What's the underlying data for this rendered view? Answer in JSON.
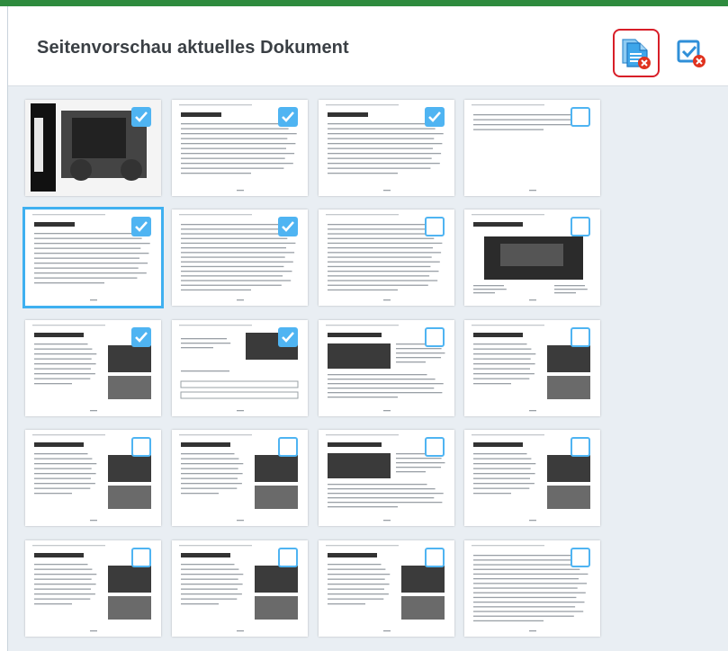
{
  "panel": {
    "title": "Seitenvorschau aktuelles Dokument",
    "accent_color": "#2e8b3e",
    "actions": [
      {
        "name": "remove-document-button",
        "icon": "document-remove-icon"
      },
      {
        "name": "deselect-all-button",
        "icon": "checkbox-remove-icon"
      }
    ]
  },
  "pages": [
    {
      "checked": true,
      "selected": false,
      "style": "cover"
    },
    {
      "checked": true,
      "selected": false,
      "style": "title-text"
    },
    {
      "checked": true,
      "selected": false,
      "style": "title-text"
    },
    {
      "checked": false,
      "selected": false,
      "style": "sparse"
    },
    {
      "checked": true,
      "selected": true,
      "style": "title-text"
    },
    {
      "checked": true,
      "selected": false,
      "style": "text"
    },
    {
      "checked": false,
      "selected": false,
      "style": "text"
    },
    {
      "checked": false,
      "selected": false,
      "style": "image-large"
    },
    {
      "checked": true,
      "selected": false,
      "style": "image-side"
    },
    {
      "checked": true,
      "selected": false,
      "style": "form"
    },
    {
      "checked": false,
      "selected": false,
      "style": "image-top"
    },
    {
      "checked": false,
      "selected": false,
      "style": "image-side"
    },
    {
      "checked": false,
      "selected": false,
      "style": "image-side"
    },
    {
      "checked": false,
      "selected": false,
      "style": "image-side"
    },
    {
      "checked": false,
      "selected": false,
      "style": "image-top"
    },
    {
      "checked": false,
      "selected": false,
      "style": "image-side"
    },
    {
      "checked": false,
      "selected": false,
      "style": "image-side"
    },
    {
      "checked": false,
      "selected": false,
      "style": "image-side"
    },
    {
      "checked": false,
      "selected": false,
      "style": "image-side"
    },
    {
      "checked": false,
      "selected": false,
      "style": "text"
    }
  ],
  "colors": {
    "checkbox": "#4fb4f2",
    "selected_outline": "#3fb0f0",
    "danger": "#d81e28",
    "grid_background": "#e9eef3"
  }
}
